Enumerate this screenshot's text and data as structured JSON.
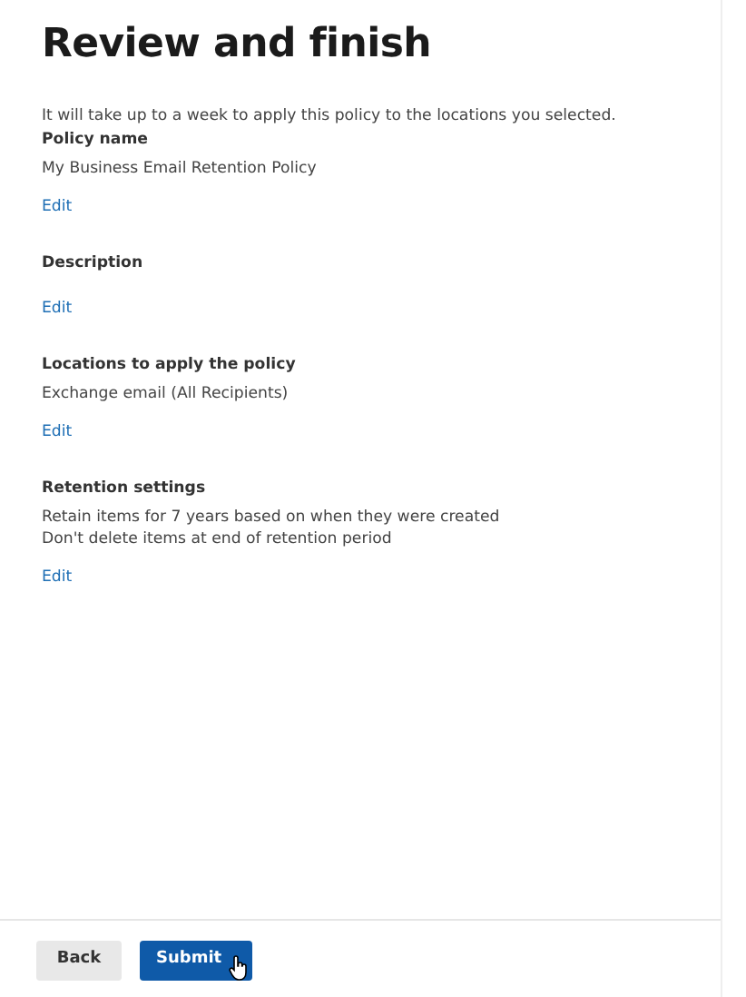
{
  "title": "Review and finish",
  "intro": "It will take up to a week to apply this policy to the locations you selected.",
  "sections": [
    {
      "heading": "Policy name",
      "lines": [
        "My Business Email Retention Policy"
      ],
      "edit": "Edit"
    },
    {
      "heading": "Description",
      "edit": "Edit"
    },
    {
      "heading": "Locations to apply the policy",
      "lines": [
        "Exchange email (All Recipients)"
      ],
      "edit": "Edit"
    },
    {
      "heading": "Retention settings",
      "lines": [
        "Retain items for 7 years based on when they were created",
        "Don't delete items at end of retention period"
      ],
      "edit": "Edit"
    }
  ],
  "buttons": [
    {
      "label": "Back",
      "kind": "secondary"
    },
    {
      "label": "Submit",
      "kind": "primary"
    }
  ]
}
